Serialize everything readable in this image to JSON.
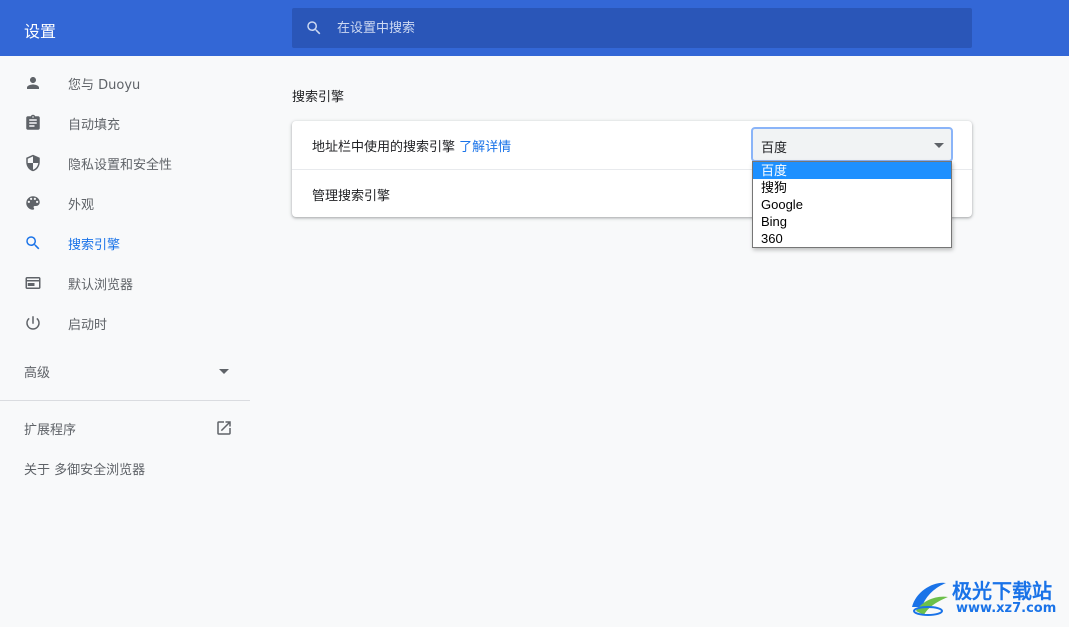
{
  "header": {
    "title": "设置",
    "search_placeholder": "在设置中搜索"
  },
  "sidebar": {
    "items": [
      {
        "label": "您与 Duoyu",
        "icon": "person-icon"
      },
      {
        "label": "自动填充",
        "icon": "clipboard-icon"
      },
      {
        "label": "隐私设置和安全性",
        "icon": "shield-icon"
      },
      {
        "label": "外观",
        "icon": "palette-icon"
      },
      {
        "label": "搜索引擎",
        "icon": "search-icon",
        "active": true
      },
      {
        "label": "默认浏览器",
        "icon": "browser-icon"
      },
      {
        "label": "启动时",
        "icon": "power-icon"
      }
    ],
    "advanced_label": "高级",
    "extensions_label": "扩展程序",
    "about_label": "关于 多御安全浏览器"
  },
  "main": {
    "section_title": "搜索引擎",
    "row1_label": "地址栏中使用的搜索引擎",
    "row1_link": "了解详情",
    "row2_label": "管理搜索引擎",
    "select_value": "百度",
    "options": [
      "百度",
      "搜狗",
      "Google",
      "Bing",
      "360"
    ],
    "selected_index": 0
  },
  "watermark": {
    "title": "极光下载站",
    "url": "www.xz7.com"
  },
  "colors": {
    "header": "#3367d6",
    "accent": "#1a73e8",
    "option_highlight": "#1e90ff"
  }
}
